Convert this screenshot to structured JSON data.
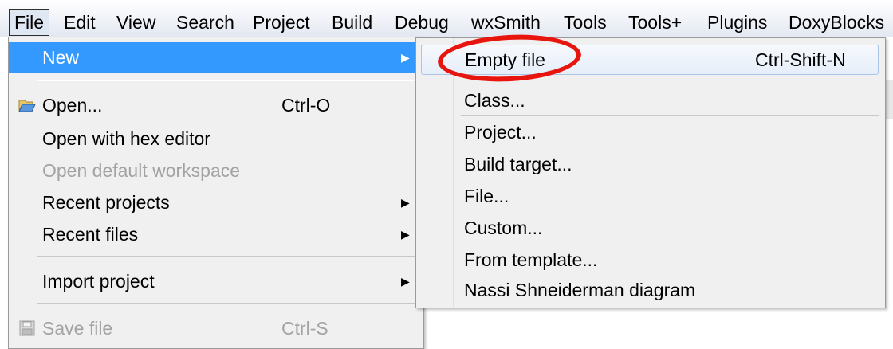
{
  "menubar": {
    "items": [
      "File",
      "Edit",
      "View",
      "Search",
      "Project",
      "Build",
      "Debug",
      "wxSmith",
      "Tools",
      "Tools+",
      "Plugins",
      "DoxyBlocks"
    ]
  },
  "file_menu": {
    "new": "New",
    "open": {
      "label": "Open...",
      "shortcut": "Ctrl-O"
    },
    "open_hex": "Open with hex editor",
    "open_workspace": "Open default workspace",
    "recent_projects": "Recent projects",
    "recent_files": "Recent files",
    "import_project": "Import project",
    "save_file": {
      "label": "Save file",
      "shortcut": "Ctrl-S"
    }
  },
  "new_submenu": {
    "empty_file": {
      "label": "Empty file",
      "shortcut": "Ctrl-Shift-N"
    },
    "items": [
      "Class...",
      "Project...",
      "Build target...",
      "File...",
      "Custom...",
      "From template...",
      "Nassi Shneiderman diagram"
    ]
  },
  "colors": {
    "highlight": "#3399ff",
    "annotation": "#e8150e"
  }
}
